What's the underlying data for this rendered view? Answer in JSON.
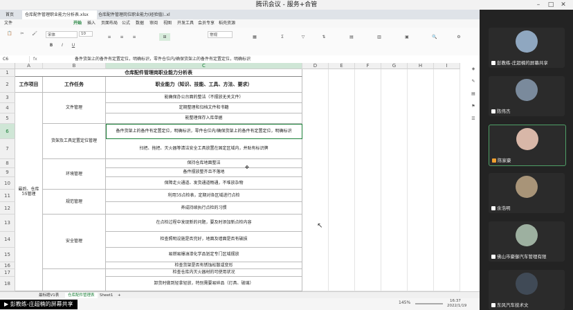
{
  "meeting": {
    "title": "腾讯会议 - 服务+合管"
  },
  "excel": {
    "tabs": [
      "首页",
      "仓库配件管理职业能力分析表.xlsx",
      "仓库配件管理岗位职业能力(经验值)..xls"
    ],
    "menus": [
      "文件",
      "开始",
      "插入",
      "页面布局",
      "公式",
      "数据",
      "审阅",
      "视图",
      "开发工具",
      "会员专享",
      "稻壳资源"
    ],
    "active_menu": "开始",
    "ribbon": {
      "font_name": "宋体",
      "font_size": "10",
      "format": "常规"
    },
    "name_box": "C6",
    "formula": "备件货架上的备件有定置定位，明确标识，零件仓位内/确保货架上的备件有定置定位，明确标识",
    "columns": [
      "A",
      "B",
      "C",
      "D",
      "E",
      "F",
      "G",
      "H",
      "I"
    ],
    "selected_column": "C",
    "rows": [
      "1",
      "2",
      "3",
      "4",
      "5",
      "6",
      "7",
      "8",
      "9",
      "10",
      "11",
      "12",
      "13",
      "14",
      "15",
      "16",
      "17",
      "18"
    ],
    "selected_row": "6",
    "table": {
      "title": "仓库配件管理岗职业能力分析表",
      "header_item": "工作项目",
      "header_task": "工作任务",
      "header_ability": "职业能力（知识、技能、工具、方法、要求）",
      "project": "最后、仓库5S管理",
      "tasks": [
        "文件管理",
        "货架及工具定置定位管理",
        "环境管理",
        "规范管理",
        "安全管理"
      ],
      "abilities": [
        "能确保办公台面的整洁（不摆放无关文件）",
        "定期整理和归档文件和书籍",
        "能整理保存入库单据",
        "备件货架上的备件有定置定位，明确标识，零件仓位内/确保货架上的备件有定置定位，明确标识",
        "扫把、拖把、灭火器等清洁安全工具放置在固定区域内，并贴有标识牌",
        "保持仓库地面整洁",
        "备件摆放整齐且不落地",
        "保障走火通道、发货通道畅通，不堆放杂物",
        "利用5S点检表，定期对各区域进行点检",
        "养成持续执行点检的习惯",
        "在点检过程中发现新的问题，要及时添加新点检内容",
        "检查照明设施是否完好，地面及墙面是否有破损",
        "易燃易爆油漆化学品划定专门区域摆放",
        "检查货架是否有锈蚀松散或变形",
        "检查仓库内灭火器材的可使用状况",
        "卸货时做到轻拿轻放，特别需要易碎品（灯具、玻璃）"
      ]
    },
    "sheets": [
      "最标题V1表",
      "仓库配件管理表",
      "Sheet1"
    ],
    "active_sheet": "仓库配件管理表",
    "zoom": "145%",
    "time": "16:37",
    "date": "2022/1/19"
  },
  "participants": [
    {
      "name": "彭教练-庄超楠的屏幕共享",
      "avatar_color": "#8fa7c0"
    },
    {
      "name": "陈伟杰",
      "avatar_color": "#7a8a9c"
    },
    {
      "name": "陈家豪",
      "avatar_color": "#d8b7a8"
    },
    {
      "name": "余浩明",
      "avatar_color": "#a89478"
    },
    {
      "name": "佛山市豪御汽车管理有限",
      "avatar_color": "#9db0a0"
    },
    {
      "name": "东风汽车技术文",
      "avatar_color": "#404a56"
    }
  ],
  "sharing_badge": "彭教练-庄超楠的屏幕共享",
  "colors": {
    "accent": "#1a7f37",
    "selection": "#4fa067"
  }
}
